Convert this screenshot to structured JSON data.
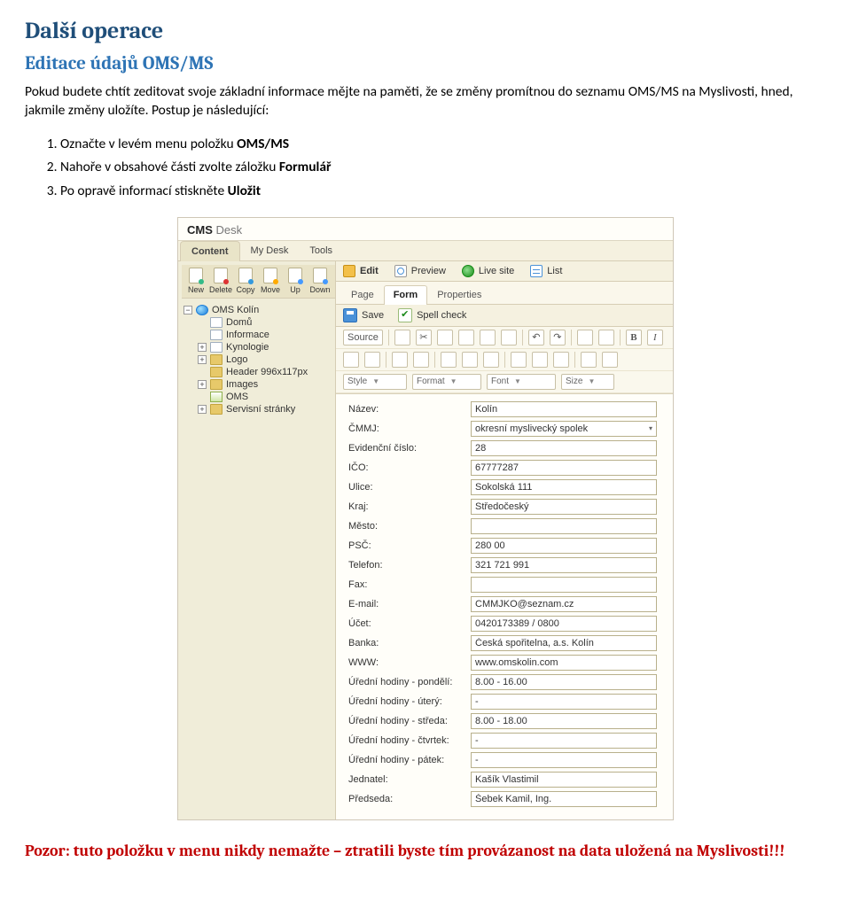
{
  "section_heading": "Další operace",
  "subsection_heading": "Editace údajů OMS/MS",
  "intro_paragraph": "Pokud budete chtít zeditovat svoje základní informace mějte na paměti, že se změny promítnou do seznamu OMS/MS na Myslivosti, hned, jakmile změny uložíte. Postup je následující:",
  "steps": {
    "s1a": "Označte v levém menu položku ",
    "s1b": "OMS/MS",
    "s2a": "Nahoře v obsahové části zvolte záložku ",
    "s2b": "Formulář",
    "s3a": "Po opravě informací stiskněte ",
    "s3b": "Uložit"
  },
  "cms": {
    "brand_a": "CMS",
    "brand_b": "Desk",
    "top_tabs": [
      "Content",
      "My Desk",
      "Tools"
    ],
    "tree_toolbar": [
      "New",
      "Delete",
      "Copy",
      "Move",
      "Up",
      "Down"
    ],
    "tree": {
      "root": "OMS Kolín",
      "children": [
        {
          "label": "Domů",
          "icon": "doc",
          "exp": ""
        },
        {
          "label": "Informace",
          "icon": "doc",
          "exp": ""
        },
        {
          "label": "Kynologie",
          "icon": "doc",
          "exp": "+"
        },
        {
          "label": "Logo",
          "icon": "folder",
          "exp": "+"
        },
        {
          "label": "Header 996x117px",
          "icon": "folder",
          "exp": ""
        },
        {
          "label": "Images",
          "icon": "folder",
          "exp": "+"
        },
        {
          "label": "OMS",
          "icon": "img",
          "exp": ""
        },
        {
          "label": "Servisní stránky",
          "icon": "folder",
          "exp": "+"
        }
      ]
    },
    "modes": [
      "Edit",
      "Preview",
      "Live site",
      "List"
    ],
    "subtabs": [
      "Page",
      "Form",
      "Properties"
    ],
    "actions": {
      "save": "Save",
      "spell": "Spell check"
    },
    "editor": {
      "source": "Source",
      "combos": {
        "style": "Style",
        "format": "Format",
        "font": "Font",
        "size": "Size"
      }
    },
    "form": [
      {
        "label": "Název:",
        "value": "Kolín",
        "type": "text"
      },
      {
        "label": "ČMMJ:",
        "value": "okresní myslivecký spolek",
        "type": "select"
      },
      {
        "label": "Evidenční číslo:",
        "value": "28",
        "type": "text"
      },
      {
        "label": "IČO:",
        "value": "67777287",
        "type": "text"
      },
      {
        "label": "Ulice:",
        "value": "Sokolská 111",
        "type": "text"
      },
      {
        "label": "Kraj:",
        "value": "Středočeský",
        "type": "text"
      },
      {
        "label": "Město:",
        "value": "",
        "type": "text"
      },
      {
        "label": "PSČ:",
        "value": "280 00",
        "type": "text"
      },
      {
        "label": "Telefon:",
        "value": "321 721 991",
        "type": "text"
      },
      {
        "label": "Fax:",
        "value": "",
        "type": "text"
      },
      {
        "label": "E-mail:",
        "value": "CMMJKO@seznam.cz",
        "type": "text"
      },
      {
        "label": "Účet:",
        "value": "0420173389 / 0800",
        "type": "text"
      },
      {
        "label": "Banka:",
        "value": "Česká spořitelna, a.s. Kolín",
        "type": "text"
      },
      {
        "label": "WWW:",
        "value": "www.omskolin.com",
        "type": "text"
      },
      {
        "label": "Úřední hodiny - pondělí:",
        "value": "8.00 - 16.00",
        "type": "text"
      },
      {
        "label": "Úřední hodiny - úterý:",
        "value": "-",
        "type": "text"
      },
      {
        "label": "Úřední hodiny - středa:",
        "value": "8.00 - 18.00",
        "type": "text"
      },
      {
        "label": "Úřední hodiny - čtvrtek:",
        "value": "-",
        "type": "text"
      },
      {
        "label": "Úřední hodiny - pátek:",
        "value": "-",
        "type": "text"
      },
      {
        "label": "Jednatel:",
        "value": "Kašík Vlastimil",
        "type": "text"
      },
      {
        "label": "Předseda:",
        "value": "Šebek Kamil, Ing.",
        "type": "text"
      }
    ]
  },
  "warning": "Pozor: tuto položku v menu nikdy nemažte – ztratili byste tím provázanost na data uložená na Myslivosti!!!"
}
